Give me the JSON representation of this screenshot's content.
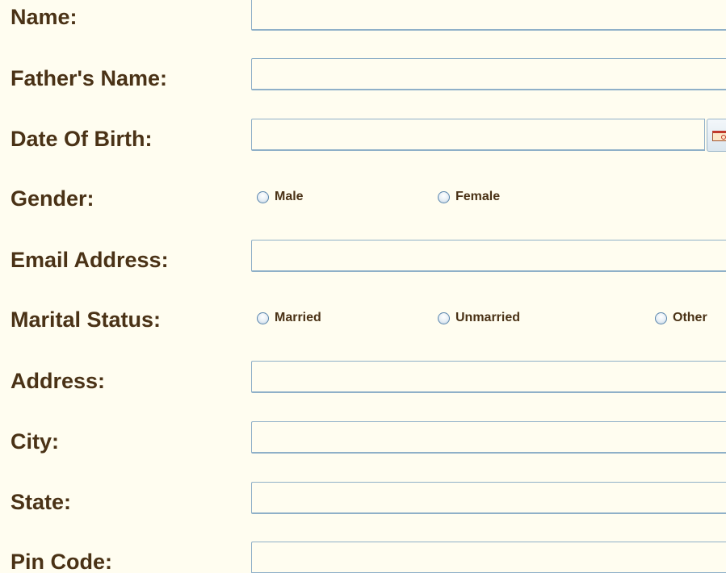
{
  "form": {
    "name_label": "Name:",
    "father_name_label": "Father's Name:",
    "dob_label": "Date Of Birth:",
    "gender_label": "Gender:",
    "gender_options": [
      "Male",
      "Female"
    ],
    "email_label": "Email Address:",
    "marital_label": "Marital Status:",
    "marital_options": [
      "Married",
      "Unmarried",
      "Other"
    ],
    "address_label": "Address:",
    "city_label": "City:",
    "state_label": "State:",
    "pin_label": "Pin Code:"
  },
  "icons": {
    "calendar": "calendar-icon"
  },
  "colors": {
    "background": "#fffdf0",
    "label_text": "#4a3216",
    "field_border": "#8fb0c8"
  }
}
